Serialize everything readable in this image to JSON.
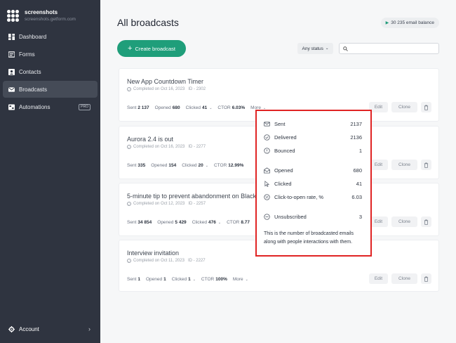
{
  "sidebar": {
    "brand_name": "screenshots",
    "brand_sub": "screenshots.getform.com",
    "items": [
      {
        "label": "Dashboard",
        "icon": "dashboard-icon"
      },
      {
        "label": "Forms",
        "icon": "forms-icon"
      },
      {
        "label": "Contacts",
        "icon": "contacts-icon"
      },
      {
        "label": "Broadcasts",
        "icon": "mail-icon",
        "active": true
      },
      {
        "label": "Automations",
        "icon": "automations-icon",
        "badge": "PRO"
      }
    ],
    "account_label": "Account"
  },
  "header": {
    "title": "All broadcasts",
    "balance": "30 235 email balance"
  },
  "toolbar": {
    "create_label": "Create broadcast",
    "status_label": "Any status",
    "search_placeholder": ""
  },
  "labels": {
    "sent": "Sent",
    "opened": "Opened",
    "clicked": "Clicked",
    "ctor": "CTOR",
    "more": "More",
    "edit": "Edit",
    "clone": "Clone"
  },
  "broadcasts": [
    {
      "title": "New App Countdown Timer",
      "status": "Completed on Oct 16, 2023",
      "id": "ID - 2302",
      "sent": "2 137",
      "opened": "680",
      "clicked": "41",
      "ctor": "6.03%"
    },
    {
      "title": "Aurora 2.4 is out",
      "status": "Completed on Oct 16, 2023",
      "id": "ID - 2277",
      "sent": "335",
      "opened": "154",
      "clicked": "20",
      "ctor": "12.99%"
    },
    {
      "title": "5-minute tip to prevent abandonment on Black",
      "status": "Completed on Oct 12, 2023",
      "id": "ID - 2257",
      "sent": "34 854",
      "opened": "5 429",
      "clicked": "476",
      "ctor": "8.77"
    },
    {
      "title": "Interview invitation",
      "status": "Completed on Oct 11, 2023",
      "id": "ID - 2227",
      "sent": "1",
      "opened": "1",
      "clicked": "1",
      "ctor": "100%"
    }
  ],
  "popover": {
    "rows": [
      {
        "label": "Sent",
        "value": "2137",
        "icon": "envelope-icon"
      },
      {
        "label": "Delivered",
        "value": "2136",
        "icon": "check-circle-icon"
      },
      {
        "label": "Bounced",
        "value": "1",
        "icon": "warning-circle-icon"
      },
      {
        "label": "Opened",
        "value": "680",
        "icon": "open-envelope-icon"
      },
      {
        "label": "Clicked",
        "value": "41",
        "icon": "cursor-icon"
      },
      {
        "label": "Click-to-open rate, %",
        "value": "6.03",
        "icon": "percent-icon"
      },
      {
        "label": "Unsubscribed",
        "value": "3",
        "icon": "minus-circle-icon"
      }
    ],
    "note": "This is the number of broadcasted emails along with people interactions with them."
  },
  "colors": {
    "accent": "#1f9e7a",
    "sidebar": "#2f3440",
    "highlight": "#e02424"
  }
}
